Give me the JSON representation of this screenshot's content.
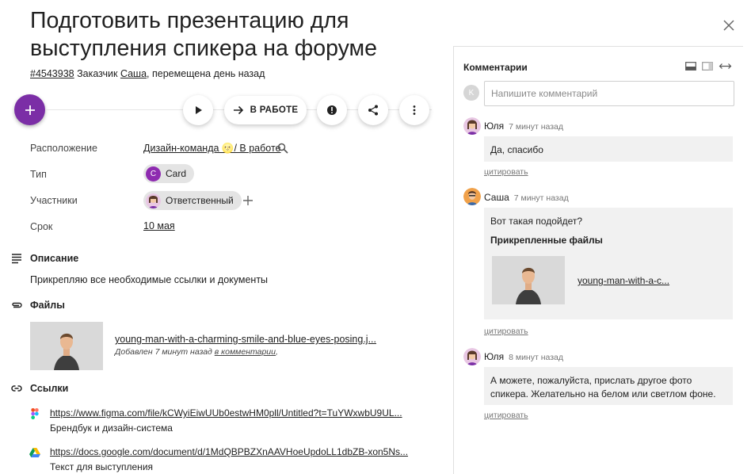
{
  "task": {
    "title": "Подготовить презентацию для выступления спикера на форуме",
    "id": "#4543938",
    "customer_label": "Заказчик",
    "customer": "Саша",
    "moved": ", перемещена день назад"
  },
  "toolbar": {
    "add": "add",
    "status": "В РАБОТЕ"
  },
  "props": {
    "location_label": "Расположение",
    "location_value": "Дизайн-команда 🌝/ В работе",
    "type_label": "Тип",
    "type_value": "Card",
    "type_avatar": "C",
    "members_label": "Участники",
    "members_value": "Ответственный",
    "due_label": "Срок",
    "due_value": "10 мая"
  },
  "description": {
    "heading": "Описание",
    "text": "Прикрепляю все необходимые ссылки и документы"
  },
  "files": {
    "heading": "Файлы",
    "name": "young-man-with-a-charming-smile-and-blue-eyes-posing.j...",
    "meta_prefix": "Добавлен 7 минут назад ",
    "meta_link": "в комментарии",
    "meta_suffix": ","
  },
  "links": {
    "heading": "Ссылки",
    "items": [
      {
        "url": "https://www.figma.com/file/kCWyiEiwUUb0estwHM0pll/Untitled?t=TuYWxwbU9UL...",
        "desc": "Брендбук и дизайн-система",
        "icon": "figma-icon"
      },
      {
        "url": "https://docs.google.com/document/d/1MdQBPBZXnAAVHoeUpdoLL1dbZB-xon5Ns...",
        "desc": "Текст для выступления",
        "icon": "google-drive-icon"
      }
    ]
  },
  "comments": {
    "heading": "Комментарии",
    "input_avatar": "K",
    "placeholder": "Напишите комментарий",
    "quote_label": "цитировать",
    "items": [
      {
        "author": "Юля",
        "time": "7 минут назад",
        "text": "Да, спасибо"
      },
      {
        "author": "Саша",
        "time": "7 минут назад",
        "text": "Вот такая подойдет?",
        "files_heading": "Прикрепленные файлы",
        "file_name": "young-man-with-a-c..."
      },
      {
        "author": "Юля",
        "time": "8 минут назад",
        "text": "А можете, пожалуйста, прислать другое фото спикера. Желательно на белом или светлом фоне."
      }
    ]
  },
  "colors": {
    "accent": "#7b2ea6",
    "chip": "#e4e4e4",
    "comment_bg": "#f1f1f1"
  }
}
